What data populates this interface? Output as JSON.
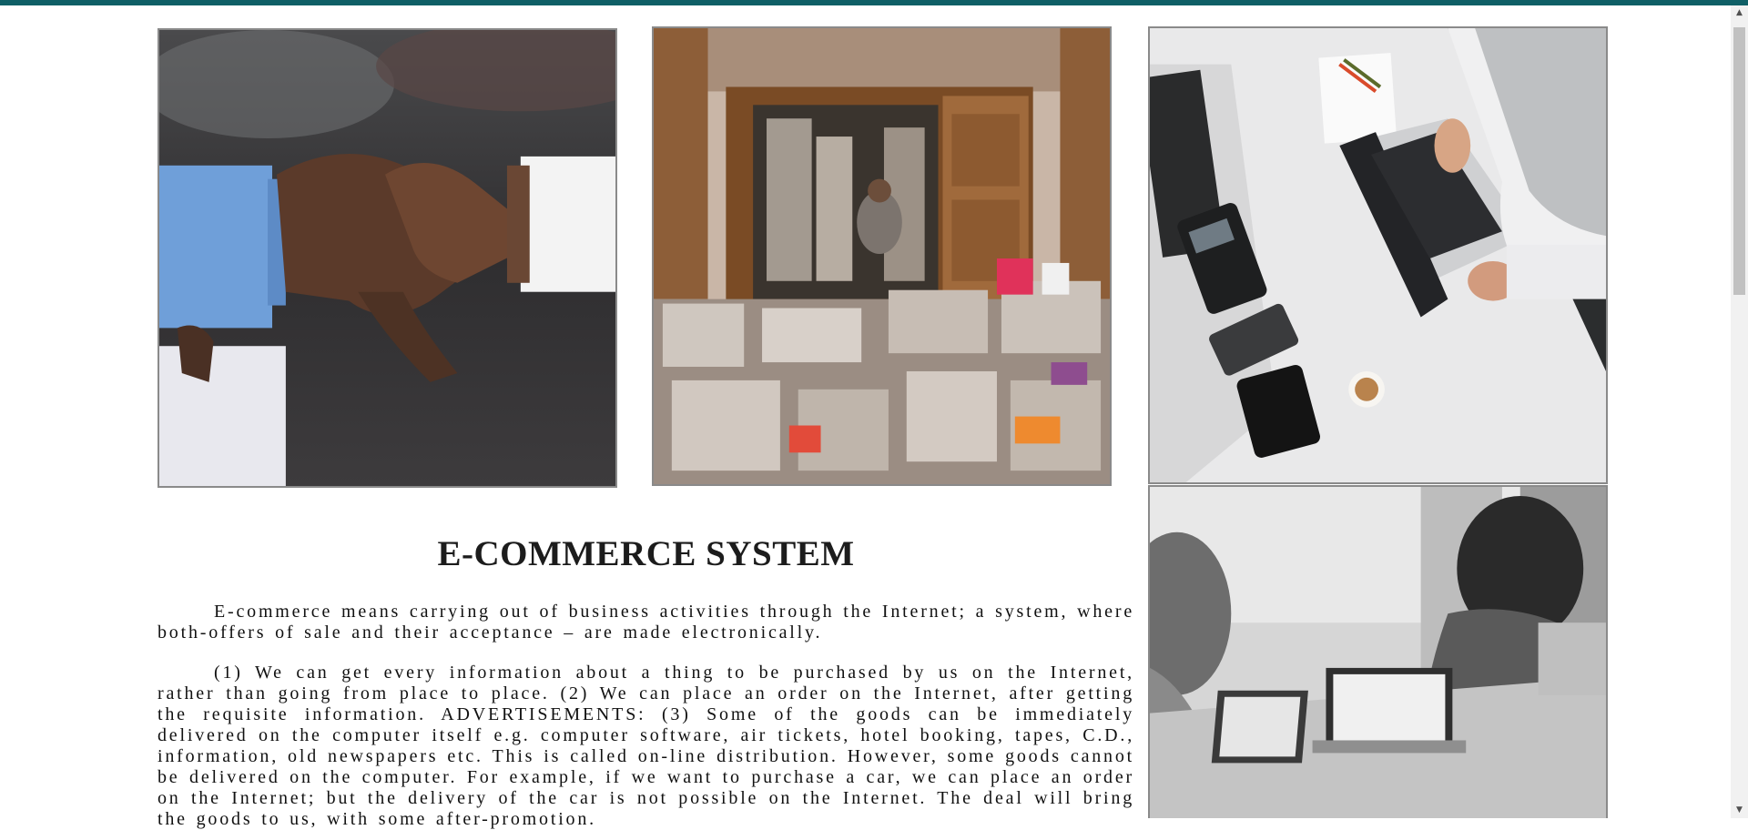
{
  "colors": {
    "top_bar": "#0f5f66",
    "text": "#111111",
    "image_border": "#8a8a8a"
  },
  "gallery": {
    "images": [
      {
        "subject": "handshake"
      },
      {
        "subject": "bookstore"
      },
      {
        "subject": "laptop-desk"
      },
      {
        "subject": "office-laptops"
      }
    ]
  },
  "content": {
    "title": "E-COMMERCE SYSTEM",
    "paragraph1": "E-commerce means carrying out of business activities through the Internet; a system, where both-offers of sale and their acceptance – are made electronically.",
    "paragraph2": "(1) We can get every information about a thing to be purchased by us on the Internet, rather than going from place to place. (2) We can place an order on the Internet, after getting the requisite information. ADVERTISEMENTS: (3) Some of the goods can be immediately delivered on the computer itself e.g. computer software, air tickets, hotel booking, tapes, C.D., information, old newspapers etc. This is called on-line distribution. However, some goods cannot be delivered on the computer. For example, if we want to purchase a car, we can place an order on the Internet; but the delivery of the car is not possible on the Internet. The deal will bring the goods to us, with some after-promotion."
  },
  "scrollbar": {
    "up_icon": "▲",
    "down_icon": "▼"
  }
}
